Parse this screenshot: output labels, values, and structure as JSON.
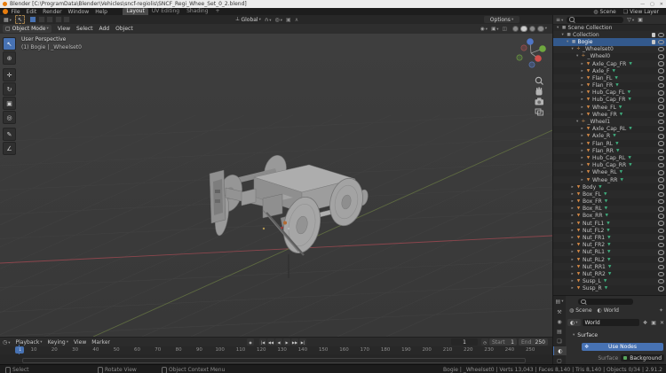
{
  "window": {
    "title": "Blender [C:\\ProgramData\\Blender\\Vehicles\\sncf-regiolis\\SNCF_Regi_Whee_Set_0_2.blend]",
    "controls": [
      "—",
      "▢",
      "✕"
    ]
  },
  "topbar": {
    "menus": [
      "File",
      "Edit",
      "Render",
      "Window",
      "Help"
    ],
    "workspaces": [
      {
        "label": "Layout",
        "active": true
      },
      {
        "label": "UV Editing",
        "active": false
      },
      {
        "label": "Shading",
        "active": false
      },
      {
        "label": "+",
        "active": false
      }
    ],
    "scene_label": "Scene",
    "view_layer_label": "View Layer"
  },
  "tool_header": {
    "orientation_label": "Global",
    "options_label": "Options"
  },
  "view_header": {
    "mode_label": "Object Mode",
    "menus": [
      "View",
      "Select",
      "Add",
      "Object"
    ]
  },
  "viewport": {
    "overlay_title": "User Perspective",
    "overlay_subtitle": "(1) Bogie | _Wheelset0",
    "tools": [
      {
        "name": "select-box-tool",
        "glyph": "↖",
        "active": true
      },
      {
        "name": "cursor-tool",
        "glyph": "⊕",
        "active": false
      },
      {
        "name": "move-tool",
        "glyph": "✛",
        "active": false
      },
      {
        "name": "rotate-tool",
        "glyph": "↻",
        "active": false
      },
      {
        "name": "scale-tool",
        "glyph": "▣",
        "active": false
      },
      {
        "name": "transform-tool",
        "glyph": "◎",
        "active": false
      },
      {
        "name": "annotate-tool",
        "glyph": "✎",
        "active": false
      },
      {
        "name": "measure-tool",
        "glyph": "∠",
        "active": false
      }
    ]
  },
  "outliner": {
    "rows": [
      {
        "label": "Scene Collection",
        "depth": 0,
        "icon": "scene",
        "expanded": true,
        "eye": false,
        "checkbox": false,
        "selected": false,
        "data_icon": false
      },
      {
        "label": "Collection",
        "depth": 1,
        "icon": "collection",
        "expanded": true,
        "eye": true,
        "checkbox": true,
        "selected": false,
        "data_icon": false
      },
      {
        "label": "Bogie",
        "depth": 2,
        "icon": "collection",
        "expanded": true,
        "eye": true,
        "checkbox": true,
        "selected": true,
        "data_icon": false
      },
      {
        "label": "_Wheelset0",
        "depth": 3,
        "icon": "empty",
        "expanded": true,
        "eye": true,
        "checkbox": false,
        "selected": false,
        "data_icon": false
      },
      {
        "label": "_Wheel0",
        "depth": 4,
        "icon": "empty",
        "expanded": true,
        "eye": true,
        "checkbox": false,
        "selected": false,
        "data_icon": false
      },
      {
        "label": "Axle_Cap_FR",
        "depth": 5,
        "icon": "mesh",
        "expanded": false,
        "eye": true,
        "checkbox": false,
        "selected": false,
        "data_icon": true
      },
      {
        "label": "Axle_F",
        "depth": 5,
        "icon": "mesh",
        "expanded": false,
        "eye": true,
        "checkbox": false,
        "selected": false,
        "data_icon": true
      },
      {
        "label": "Flan_FL",
        "depth": 5,
        "icon": "mesh",
        "expanded": false,
        "eye": true,
        "checkbox": false,
        "selected": false,
        "data_icon": true
      },
      {
        "label": "Flan_FR",
        "depth": 5,
        "icon": "mesh",
        "expanded": false,
        "eye": true,
        "checkbox": false,
        "selected": false,
        "data_icon": true
      },
      {
        "label": "Hub_Cap_FL",
        "depth": 5,
        "icon": "mesh",
        "expanded": false,
        "eye": true,
        "checkbox": false,
        "selected": false,
        "data_icon": true
      },
      {
        "label": "Hub_Cap_FR",
        "depth": 5,
        "icon": "mesh",
        "expanded": false,
        "eye": true,
        "checkbox": false,
        "selected": false,
        "data_icon": true
      },
      {
        "label": "Whee_FL",
        "depth": 5,
        "icon": "mesh",
        "expanded": false,
        "eye": true,
        "checkbox": false,
        "selected": false,
        "data_icon": true
      },
      {
        "label": "Whee_FR",
        "depth": 5,
        "icon": "mesh",
        "expanded": false,
        "eye": true,
        "checkbox": false,
        "selected": false,
        "data_icon": true
      },
      {
        "label": "_Wheel1",
        "depth": 4,
        "icon": "empty",
        "expanded": true,
        "eye": true,
        "checkbox": false,
        "selected": false,
        "data_icon": false
      },
      {
        "label": "Axle_Cap_RL",
        "depth": 5,
        "icon": "mesh",
        "expanded": false,
        "eye": true,
        "checkbox": false,
        "selected": false,
        "data_icon": true
      },
      {
        "label": "Axle_R",
        "depth": 5,
        "icon": "mesh",
        "expanded": false,
        "eye": true,
        "checkbox": false,
        "selected": false,
        "data_icon": true
      },
      {
        "label": "Flan_RL",
        "depth": 5,
        "icon": "mesh",
        "expanded": false,
        "eye": true,
        "checkbox": false,
        "selected": false,
        "data_icon": true
      },
      {
        "label": "Flan_RR",
        "depth": 5,
        "icon": "mesh",
        "expanded": false,
        "eye": true,
        "checkbox": false,
        "selected": false,
        "data_icon": true
      },
      {
        "label": "Hub_Cap_RL",
        "depth": 5,
        "icon": "mesh",
        "expanded": false,
        "eye": true,
        "checkbox": false,
        "selected": false,
        "data_icon": true
      },
      {
        "label": "Hub_Cap_RR",
        "depth": 5,
        "icon": "mesh",
        "expanded": false,
        "eye": true,
        "checkbox": false,
        "selected": false,
        "data_icon": true
      },
      {
        "label": "Whee_RL",
        "depth": 5,
        "icon": "mesh",
        "expanded": false,
        "eye": true,
        "checkbox": false,
        "selected": false,
        "data_icon": true
      },
      {
        "label": "Whee_RR",
        "depth": 5,
        "icon": "mesh",
        "expanded": false,
        "eye": true,
        "checkbox": false,
        "selected": false,
        "data_icon": true
      },
      {
        "label": "Body",
        "depth": 3,
        "icon": "mesh",
        "expanded": false,
        "eye": true,
        "checkbox": false,
        "selected": false,
        "data_icon": true
      },
      {
        "label": "Box_FL",
        "depth": 3,
        "icon": "mesh",
        "expanded": false,
        "eye": true,
        "checkbox": false,
        "selected": false,
        "data_icon": true
      },
      {
        "label": "Box_FR",
        "depth": 3,
        "icon": "mesh",
        "expanded": false,
        "eye": true,
        "checkbox": false,
        "selected": false,
        "data_icon": true
      },
      {
        "label": "Box_RL",
        "depth": 3,
        "icon": "mesh",
        "expanded": false,
        "eye": true,
        "checkbox": false,
        "selected": false,
        "data_icon": true
      },
      {
        "label": "Box_RR",
        "depth": 3,
        "icon": "mesh",
        "expanded": false,
        "eye": true,
        "checkbox": false,
        "selected": false,
        "data_icon": true
      },
      {
        "label": "Nut_FL1",
        "depth": 3,
        "icon": "mesh",
        "expanded": false,
        "eye": true,
        "checkbox": false,
        "selected": false,
        "data_icon": true
      },
      {
        "label": "Nut_FL2",
        "depth": 3,
        "icon": "mesh",
        "expanded": false,
        "eye": true,
        "checkbox": false,
        "selected": false,
        "data_icon": true
      },
      {
        "label": "Nut_FR1",
        "depth": 3,
        "icon": "mesh",
        "expanded": false,
        "eye": true,
        "checkbox": false,
        "selected": false,
        "data_icon": true
      },
      {
        "label": "Nut_FR2",
        "depth": 3,
        "icon": "mesh",
        "expanded": false,
        "eye": true,
        "checkbox": false,
        "selected": false,
        "data_icon": true
      },
      {
        "label": "Nut_RL1",
        "depth": 3,
        "icon": "mesh",
        "expanded": false,
        "eye": true,
        "checkbox": false,
        "selected": false,
        "data_icon": true
      },
      {
        "label": "Nut_RL2",
        "depth": 3,
        "icon": "mesh",
        "expanded": false,
        "eye": true,
        "checkbox": false,
        "selected": false,
        "data_icon": true
      },
      {
        "label": "Nut_RR1",
        "depth": 3,
        "icon": "mesh",
        "expanded": false,
        "eye": true,
        "checkbox": false,
        "selected": false,
        "data_icon": true
      },
      {
        "label": "Nut_RR2",
        "depth": 3,
        "icon": "mesh",
        "expanded": false,
        "eye": true,
        "checkbox": false,
        "selected": false,
        "data_icon": true
      },
      {
        "label": "Susp_L",
        "depth": 3,
        "icon": "mesh",
        "expanded": false,
        "eye": true,
        "checkbox": false,
        "selected": false,
        "data_icon": true
      },
      {
        "label": "Susp_R",
        "depth": 3,
        "icon": "mesh",
        "expanded": false,
        "eye": true,
        "checkbox": false,
        "selected": false,
        "data_icon": true
      }
    ]
  },
  "timeline": {
    "menus": [
      "Playback",
      "Keying",
      "View",
      "Marker"
    ],
    "playback_buttons": [
      "|◀",
      "◀◀",
      "◀",
      "▶",
      "▶▶",
      "▶|"
    ],
    "current_frame": "1",
    "frame_field": "1",
    "start_label": "Start",
    "start_value": "1",
    "end_label": "End",
    "end_value": "250",
    "ticks": [
      "10",
      "20",
      "30",
      "40",
      "50",
      "60",
      "70",
      "80",
      "90",
      "100",
      "110",
      "120",
      "130",
      "140",
      "150",
      "160",
      "170",
      "180",
      "190",
      "200",
      "210",
      "220",
      "230",
      "240",
      "250"
    ]
  },
  "properties": {
    "breadcrumb_scene": "Scene",
    "breadcrumb_world": "World",
    "datablock_name": "World",
    "panel_surface": "Surface",
    "use_nodes_label": "Use Nodes",
    "surface_label": "Surface",
    "surface_value": "Background",
    "tabs": [
      {
        "name": "tool-icon",
        "glyph": "⚒",
        "active": false
      },
      {
        "name": "render-icon",
        "glyph": "◉",
        "active": false
      },
      {
        "name": "output-icon",
        "glyph": "▤",
        "active": false
      },
      {
        "name": "viewlayer-icon",
        "glyph": "❏",
        "active": false
      },
      {
        "name": "world-icon",
        "glyph": "◐",
        "active": true
      },
      {
        "name": "object-icon",
        "glyph": "▢",
        "active": false
      }
    ]
  },
  "statusbar": {
    "hint_left": "Select",
    "hint_middle": "Rotate View",
    "hint_right": "Object Context Menu",
    "info": "Bogie | _Wheelset0 | Verts 13,043 | Faces 8,140 | Tris 8,140 | Objects 0/34 | 2.91.2"
  },
  "colors": {
    "accent": "#4772b3",
    "selection": "#33598c",
    "mesh_icon": "#d78a45",
    "data_icon": "#3fae7e",
    "axis_x": "#9a4850",
    "axis_y": "#6b7c43"
  }
}
